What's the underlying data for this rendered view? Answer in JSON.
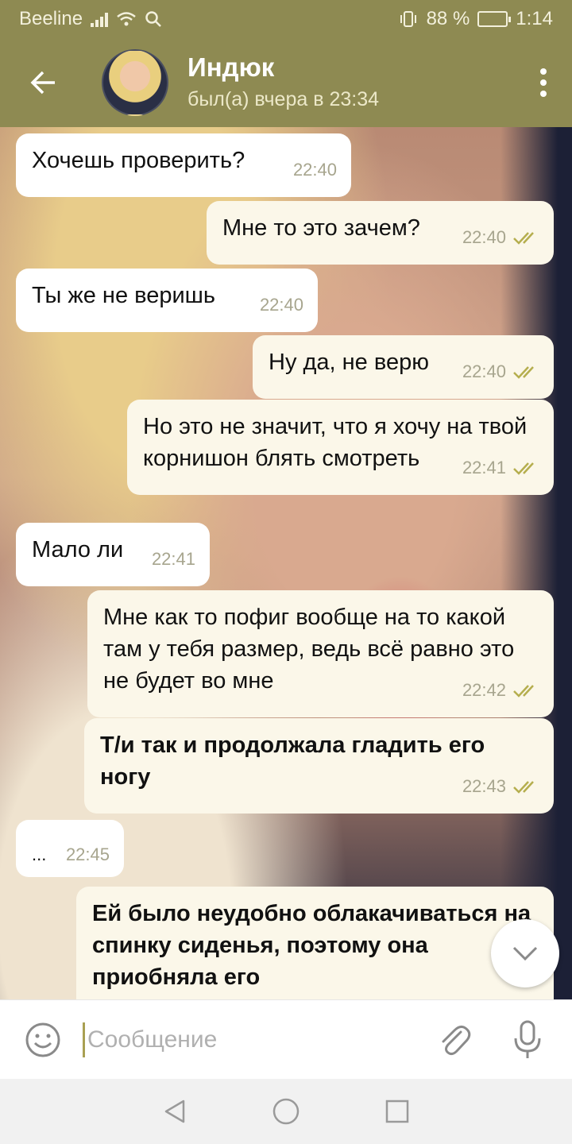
{
  "status_bar": {
    "carrier": "Beeline",
    "battery_text": "88 %",
    "time": "1:14",
    "battery_level": 0.88
  },
  "header": {
    "contact_name": "Индюк",
    "last_seen": "был(а) вчера в 23:34"
  },
  "messages": [
    {
      "dir": "in",
      "text": "Хочешь проверить?",
      "time": "22:40"
    },
    {
      "dir": "out",
      "text": "Мне то это зачем?",
      "time": "22:40",
      "read": true
    },
    {
      "dir": "in",
      "text": "Ты же не веришь",
      "time": "22:40"
    },
    {
      "dir": "out",
      "text": "Ну да, не верю",
      "time": "22:40",
      "read": true
    },
    {
      "dir": "out",
      "text": "Но это не значит, что я хочу на твой корнишон блять смотреть",
      "time": "22:41",
      "read": true
    },
    {
      "dir": "in",
      "text": "Мало ли",
      "time": "22:41"
    },
    {
      "dir": "out",
      "text": "Мне как то пофиг вообще на то какой там у тебя размер, ведь всё равно это не будет во мне",
      "time": "22:42",
      "read": true
    },
    {
      "dir": "out",
      "text": "Т/и так и продолжала гладить его ногу",
      "time": "22:43",
      "read": true,
      "bold": true
    },
    {
      "dir": "in",
      "text": "...",
      "time": "22:45"
    },
    {
      "dir": "out",
      "text": "Ей было неудобно облакачиваться на спинку сиденья, поэтому она приобняла его",
      "time": "",
      "read": false,
      "bold": true
    }
  ],
  "input": {
    "placeholder": "Сообщение"
  },
  "colors": {
    "header": "#8e8a52",
    "incoming_bubble": "#ffffff",
    "outgoing_bubble": "#fbf7e9",
    "check": "#b5ae4e"
  }
}
